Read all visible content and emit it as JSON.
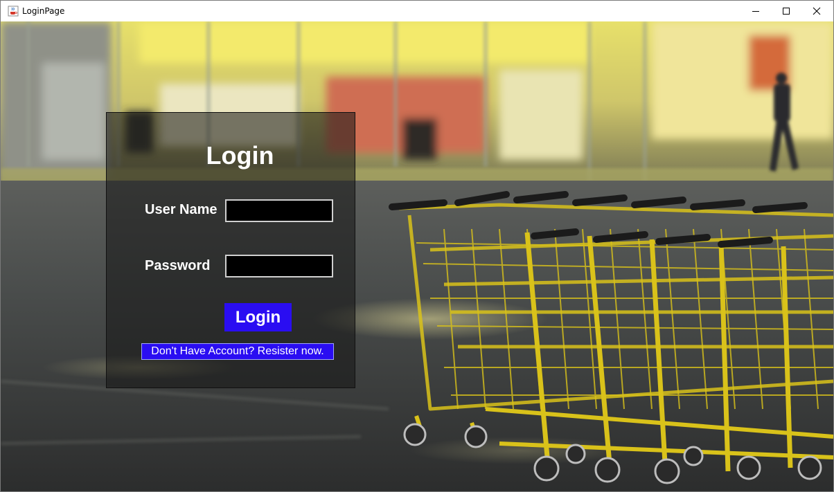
{
  "window": {
    "title": "LoginPage",
    "app_icon": "java-cup-icon",
    "controls": [
      "minimize-icon",
      "maximize-icon",
      "close-icon"
    ]
  },
  "login": {
    "heading": "Login",
    "username_label": "User Name",
    "username_value": "",
    "password_label": "Password",
    "password_value": "",
    "login_button": "Login",
    "register_link": "Don't Have Account? Resister now."
  },
  "colors": {
    "button_blue": "#2a0df2",
    "panel_bg": "rgba(20,20,20,0.55)",
    "input_bg": "#000000",
    "cart_yellow": "#d9c21a"
  }
}
